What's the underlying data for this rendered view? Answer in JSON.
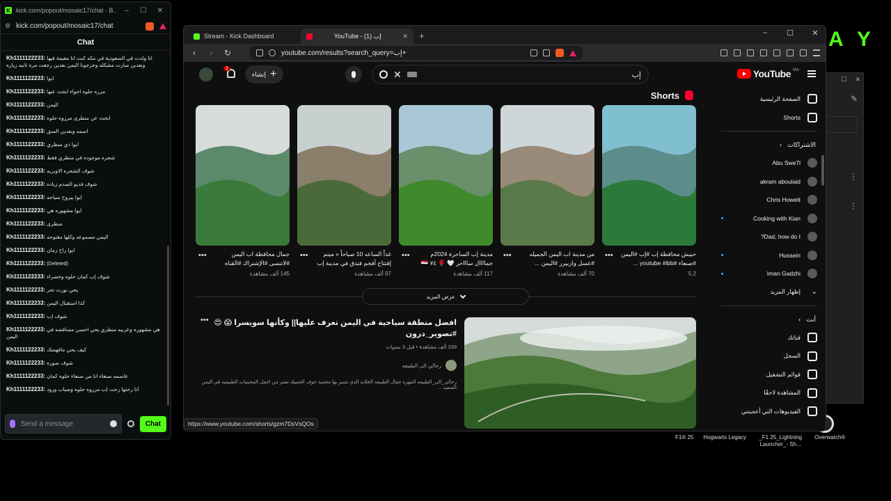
{
  "chat_window": {
    "title": "kick.com/popout/mosaic17/chat - B...",
    "url": "kick.com/popout/mosaic17/chat",
    "header": "Chat",
    "messages": [
      {
        "user": "Kh1111122233:",
        "text": "انا ولدت في السعودية في مكه كنت انا مقيمة فيها وبعدين صارت مشكله وخرجونا اليمن بعدين رجعت مره ثانيه زياره"
      },
      {
        "user": "Kh1111122233:",
        "text": "ايوا"
      },
      {
        "user": "Kh1111122233:",
        "text": "مرره حلوه اجواء ابحث عنها"
      },
      {
        "user": "Kh1111122233:",
        "text": "اليمن"
      },
      {
        "user": "Kh1111122233:",
        "text": "ابحث عن منطرى مرروه حلوه"
      },
      {
        "user": "Kh1111122233:",
        "text": "اسمه وبعدين السق"
      },
      {
        "user": "Kh1111122233:",
        "text": "ايوا ذي منظري"
      },
      {
        "user": "Kh1111122233:",
        "text": "شجره موجوده في منظري فقط"
      },
      {
        "user": "Kh1111122233:",
        "text": "شوف الشجره الاوبريه"
      },
      {
        "user": "Kh1111122233:",
        "text": "شوف فديو الصدم زياده"
      },
      {
        "user": "Kh1111122233:",
        "text": "ايوا بيروح سياحه"
      },
      {
        "user": "Kh1111122233:",
        "text": "ايوا مشهوره هي"
      },
      {
        "user": "Kh1111122233:",
        "text": "منظرى"
      },
      {
        "user": "Kh1111122233:",
        "text": "اليمن مصموعه وكلها مقتوحه"
      },
      {
        "user": "Kh1111122233:",
        "text": "ايوا راح زمان"
      },
      {
        "user": "Kh1111122233:",
        "text": "(Deleted)"
      },
      {
        "user": "Kh1111122233:",
        "text": "شوف إب كمان حلوه وخضراء"
      },
      {
        "user": "Kh1111122233:",
        "text": "يحي نورت تحر"
      },
      {
        "user": "Kh1111122233:",
        "text": "كذا استقبال اليمن"
      },
      {
        "user": "Kh1111122233:",
        "text": "شوف إب"
      },
      {
        "user": "Kh1111122233:",
        "text": "هي مشهوره وعربيه منظري يحي احسن مسافضه في اليمن"
      },
      {
        "user": "Kh1111122233:",
        "text": "كيف يحي مافهمتك"
      },
      {
        "user": "Kh1111122233:",
        "text": "شوف صوره"
      },
      {
        "user": "Kh1111122233:",
        "text": "عاصمه صنعاء انا من صنعاء حلوه كمان"
      },
      {
        "user": "Kh1111122233:",
        "text": "انا رحتها رحت إب مرروه حلوه وضباب ورود"
      }
    ],
    "input_placeholder": "Send a message",
    "send_label": "Chat"
  },
  "browser": {
    "tabs": [
      {
        "label": "Stream - Kick Dashboard",
        "active": false,
        "color": "#53fc18"
      },
      {
        "label": "YouTube - (1) إب",
        "active": true,
        "color": "#ff0033"
      }
    ],
    "new_tab": "+",
    "url": "youtube.com/results?search_query=إب+",
    "status_url": "https://www.youtube.com/shorts/gzm7DsVsQOs"
  },
  "youtube": {
    "logo_text": "YouTube",
    "logo_region": "MA",
    "search_value": "إب",
    "create_label": "إنشاء",
    "notifications_count": "1",
    "sidebar": {
      "top": [
        {
          "label": "الصفحة الرئيسية",
          "icon": "home-icon"
        },
        {
          "label": "Shorts",
          "icon": "shorts-icon"
        }
      ],
      "subs_title": "الاشتراكات",
      "subs": [
        {
          "label": "Abu Swe7l",
          "dot": false
        },
        {
          "label": "akram aboulaid",
          "dot": false
        },
        {
          "label": "Chris Howett",
          "dot": false
        },
        {
          "label": "Cooking with Kian",
          "dot": true
        },
        {
          "label": "Dad, how do I?",
          "dot": false
        },
        {
          "label": "Hussein",
          "dot": true
        },
        {
          "label": "Iman Gadzhi",
          "dot": true
        }
      ],
      "show_more": "إظهار المزيد",
      "you_title": "أنت",
      "you": [
        {
          "label": "قناتك",
          "icon": "channel-icon"
        },
        {
          "label": "السجل",
          "icon": "history-icon"
        },
        {
          "label": "قوائم التشغيل",
          "icon": "playlists-icon"
        },
        {
          "label": "المشاهدة لاحقًا",
          "icon": "watch-later-icon"
        },
        {
          "label": "الفيديوهات التي أعجبتني",
          "icon": "liked-icon"
        }
      ]
    },
    "shorts_heading": "Shorts",
    "shorts": [
      {
        "title": "حبيش محافظة إب #إب #اليمن #صنعاء #youtube #ibb ...",
        "views": "5.2"
      },
      {
        "title": "من مدينة اب اليمن الجميله #عسل وازبيرر #اليمن ...",
        "views": "70 ألف مشاهدة"
      },
      {
        "title": "مدينة إب الساحرة 2024م جماااال ساااحر 🤍 🌹 ٧٤ 🇾🇪",
        "views": "117 ألف مشاهدة"
      },
      {
        "title": "غداً الساعه 10 صباحاً » ميتم إفتتاح أفخم فندق في مدينة إب ...",
        "views": "97 ألف مشاهدة"
      },
      {
        "title": "جمال محافظة اب اليمن #لاتنسى #الإشتراك #القناه",
        "views": "145 ألف مشاهدة"
      }
    ],
    "show_more_label": "عرض المزيد",
    "video": {
      "title": "افضل منطقة سياحية في اليمن تعرف عليها|| وكأنها سويسرا 😱 😍 #تصوير_درون",
      "meta": "339 ألف مشاهدة • قبل 3 سنوات",
      "channel": "رحالي الى الطبيعه",
      "desc": "رحالي_الى_الطبيعه المهره جمال الطبيعه الخلابه الذي تتميز بها محمية حوف الجميلة تعتبر من اجمل المحميات الطبيعيه في اليمن السعيد ..."
    }
  },
  "desktop": {
    "brand_letters": "AY",
    "icons": [
      "F1® 25",
      "Hogwarts Legacy",
      "_F1 25_Lightning Launcher_- Sh...",
      "Overwatch®"
    ]
  }
}
